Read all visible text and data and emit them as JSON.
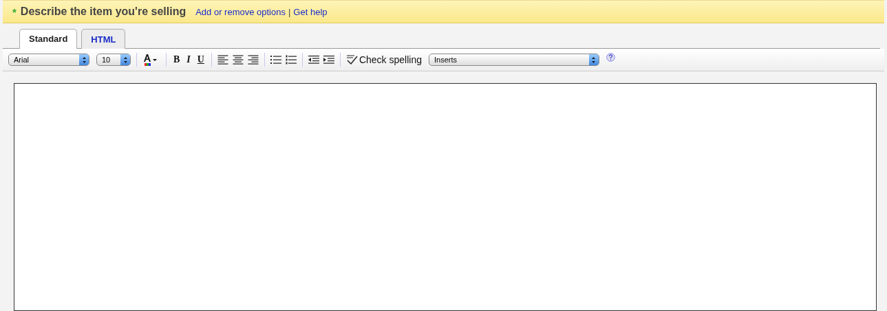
{
  "header": {
    "required_mark": "*",
    "title": "Describe the item you're selling",
    "links": [
      "Add or remove options",
      "Get help"
    ],
    "separator": "|"
  },
  "tabs": [
    {
      "label": "Standard",
      "selected": true
    },
    {
      "label": "HTML",
      "selected": false
    }
  ],
  "toolbar": {
    "font": "Arial",
    "size": "10",
    "bold": "B",
    "italic": "I",
    "underline": "U",
    "spell": "Check spelling",
    "inserts": "Inserts"
  }
}
